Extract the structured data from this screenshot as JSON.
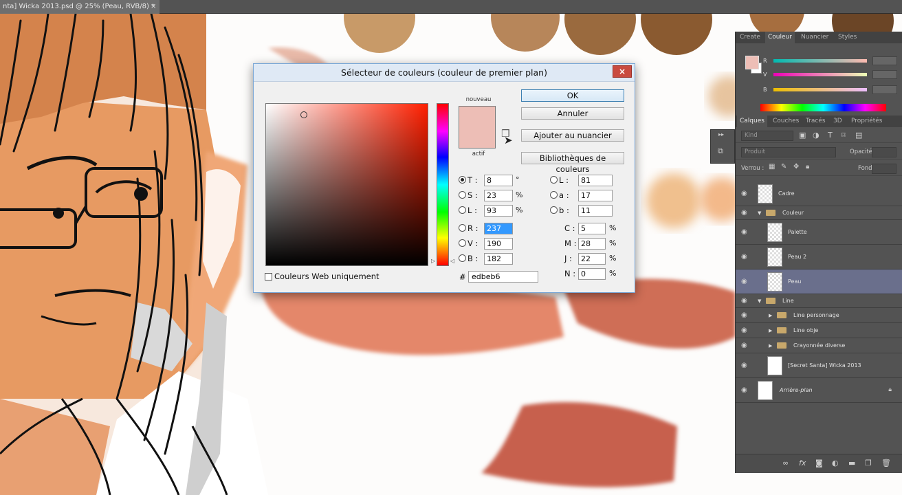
{
  "document": {
    "tab_title": "nta] Wicka 2013.psd @ 25% (Peau, RVB/8) *",
    "tab_close": "×"
  },
  "dialog": {
    "title": "Sélecteur de couleurs (couleur de premier plan)",
    "close": "×",
    "label_new": "nouveau",
    "label_current": "actif",
    "current_color": "#edbeb6",
    "buttons": {
      "ok": "OK",
      "cancel": "Annuler",
      "add_swatch": "Ajouter au nuancier",
      "libraries": "Bibliothèques de couleurs"
    },
    "hsb": {
      "h_label": "T :",
      "h_value": "8",
      "h_unit": "°",
      "s_label": "S :",
      "s_value": "23",
      "s_unit": "%",
      "b_label": "L :",
      "b_value": "93",
      "b_unit": "%"
    },
    "rgb": {
      "r_label": "R :",
      "r_value": "237",
      "g_label": "V :",
      "g_value": "190",
      "b_label": "B :",
      "b_value": "182"
    },
    "lab": {
      "l_label": "L :",
      "l_value": "81",
      "a_label": "a :",
      "a_value": "17",
      "b_label": "b :",
      "b_value": "11"
    },
    "cmyk": {
      "c_label": "C :",
      "c_value": "5",
      "m_label": "M :",
      "m_value": "28",
      "y_label": "J :",
      "y_value": "22",
      "k_label": "N :",
      "k_value": "0",
      "unit": "%"
    },
    "web_only": "Couleurs Web uniquement",
    "hex_label": "#",
    "hex_value": "edbeb6"
  },
  "color_panel": {
    "tabs": [
      "Create",
      "Couleur",
      "Nuancier",
      "Styles"
    ],
    "active_tab": "Couleur",
    "r_label": "R",
    "g_label": "V",
    "b_label": "B"
  },
  "layers_panel": {
    "tabs": [
      "Calques",
      "Couches",
      "Tracés",
      "3D",
      "Propriétés"
    ],
    "active_tab": "Calques",
    "filter_kind": "Kind",
    "blend_mode": "Produit",
    "opacity_label": "Opacité :",
    "lock_label": "Verrou :",
    "fill_label": "Fond :",
    "layers": [
      {
        "name": "Cadre",
        "type": "layer",
        "indent": 0
      },
      {
        "name": "Couleur",
        "type": "group-open",
        "indent": 0
      },
      {
        "name": "Palette",
        "type": "layer",
        "indent": 1
      },
      {
        "name": "Peau 2",
        "type": "layer",
        "indent": 1
      },
      {
        "name": "Peau",
        "type": "layer",
        "indent": 1,
        "selected": true
      },
      {
        "name": "Line",
        "type": "group-open",
        "indent": 0
      },
      {
        "name": "Line personnage",
        "type": "group",
        "indent": 1
      },
      {
        "name": "Line obje",
        "type": "group",
        "indent": 1
      },
      {
        "name": "Crayonnée diverse",
        "type": "group",
        "indent": 1
      },
      {
        "name": "[Secret Santa] Wicka 2013",
        "type": "layer",
        "indent": 0
      },
      {
        "name": "Arrière-plan",
        "type": "background",
        "indent": 0
      }
    ]
  }
}
